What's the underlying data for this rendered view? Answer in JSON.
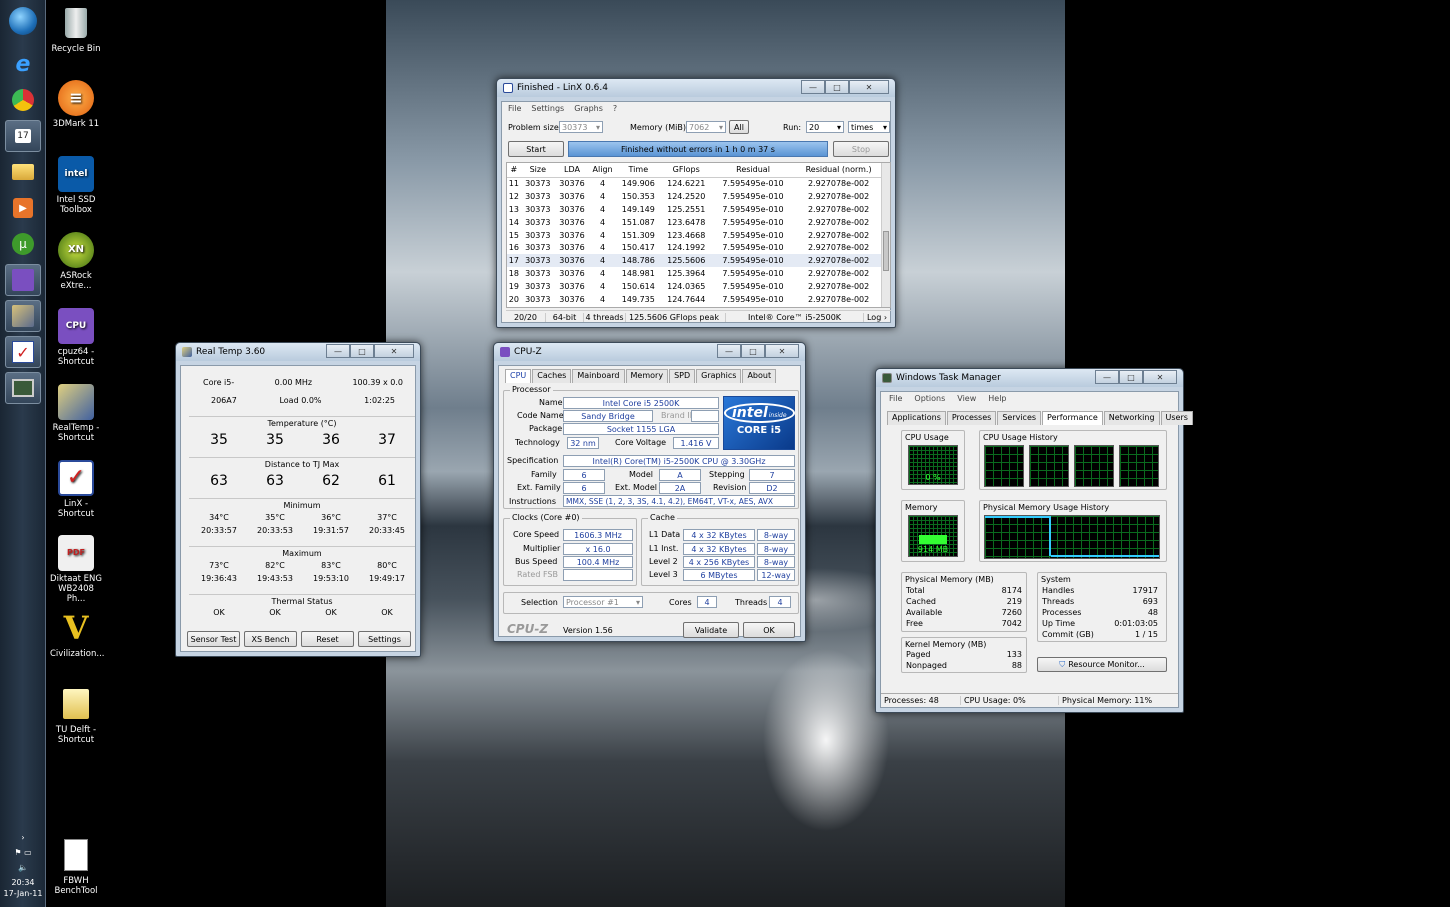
{
  "taskbar": {
    "clock_time": "20:34",
    "clock_date": "17-Jan-11"
  },
  "desktop_icons": [
    {
      "label": "Recycle Bin"
    },
    {
      "label": "3DMark 11"
    },
    {
      "label": "Intel SSD Toolbox"
    },
    {
      "label": "ASRock eXtre..."
    },
    {
      "label": "cpuz64 - Shortcut"
    },
    {
      "label": "RealTemp - Shortcut"
    },
    {
      "label": "LinX - Shortcut"
    },
    {
      "label": "Diktaat ENG WB2408 Ph..."
    },
    {
      "label": "Civilization..."
    },
    {
      "label": "TU Delft - Shortcut"
    },
    {
      "label": "FBWH BenchTool"
    }
  ],
  "linx": {
    "title": "Finished - LinX 0.6.4",
    "menu": [
      "File",
      "Settings",
      "Graphs",
      "?"
    ],
    "problem_size_label": "Problem size:",
    "problem_size": "30373",
    "memory_label": "Memory (MiB):",
    "memory": "7062",
    "all_label": "All",
    "run_label": "Run:",
    "run": "20",
    "run_unit": "times",
    "start_label": "Start",
    "status": "Finished without errors in 1 h 0 m 37 s",
    "stop_label": "Stop",
    "columns": [
      "#",
      "Size",
      "LDA",
      "Align",
      "Time",
      "GFlops",
      "Residual",
      "Residual (norm.)"
    ],
    "rows": [
      [
        "11",
        "30373",
        "30376",
        "4",
        "149.906",
        "124.6221",
        "7.595495e-010",
        "2.927078e-002"
      ],
      [
        "12",
        "30373",
        "30376",
        "4",
        "150.353",
        "124.2520",
        "7.595495e-010",
        "2.927078e-002"
      ],
      [
        "13",
        "30373",
        "30376",
        "4",
        "149.149",
        "125.2551",
        "7.595495e-010",
        "2.927078e-002"
      ],
      [
        "14",
        "30373",
        "30376",
        "4",
        "151.087",
        "123.6478",
        "7.595495e-010",
        "2.927078e-002"
      ],
      [
        "15",
        "30373",
        "30376",
        "4",
        "151.309",
        "123.4668",
        "7.595495e-010",
        "2.927078e-002"
      ],
      [
        "16",
        "30373",
        "30376",
        "4",
        "150.417",
        "124.1992",
        "7.595495e-010",
        "2.927078e-002"
      ],
      [
        "17",
        "30373",
        "30376",
        "4",
        "148.786",
        "125.5606",
        "7.595495e-010",
        "2.927078e-002"
      ],
      [
        "18",
        "30373",
        "30376",
        "4",
        "148.981",
        "125.3964",
        "7.595495e-010",
        "2.927078e-002"
      ],
      [
        "19",
        "30373",
        "30376",
        "4",
        "150.614",
        "124.0365",
        "7.595495e-010",
        "2.927078e-002"
      ],
      [
        "20",
        "30373",
        "30376",
        "4",
        "149.735",
        "124.7644",
        "7.595495e-010",
        "2.927078e-002"
      ]
    ],
    "status_bar": {
      "progress": "20/20",
      "arch": "64-bit",
      "threads": "4 threads",
      "peak": "125.5606 GFlops peak",
      "cpu": "Intel® Core™ i5-2500K",
      "log": "Log ›"
    }
  },
  "realtemp": {
    "title": "Real Temp 3.60",
    "cpu_name": "Core i5-",
    "mhz": "0.00 MHz",
    "multiplier": "100.39 x 0.0",
    "cpuid": "206A7",
    "load": "Load  0.0%",
    "uptime": "1:02:25",
    "temp_heading": "Temperature (°C)",
    "temps": [
      "35",
      "35",
      "36",
      "37"
    ],
    "tjmax_heading": "Distance to TJ Max",
    "distances": [
      "63",
      "63",
      "62",
      "61"
    ],
    "min_heading": "Minimum",
    "min_temps": [
      "34°C",
      "35°C",
      "36°C",
      "37°C"
    ],
    "min_times": [
      "20:33:57",
      "20:33:53",
      "19:31:57",
      "20:33:45"
    ],
    "max_heading": "Maximum",
    "max_temps": [
      "73°C",
      "82°C",
      "83°C",
      "80°C"
    ],
    "max_times": [
      "19:36:43",
      "19:43:53",
      "19:53:10",
      "19:49:17"
    ],
    "thermal_heading": "Thermal Status",
    "thermal": [
      "OK",
      "OK",
      "OK",
      "OK"
    ],
    "buttons": [
      "Sensor Test",
      "XS Bench",
      "Reset",
      "Settings"
    ]
  },
  "cpuz": {
    "title": "CPU-Z",
    "tabs": [
      "CPU",
      "Caches",
      "Mainboard",
      "Memory",
      "SPD",
      "Graphics",
      "About"
    ],
    "processor_group": "Processor",
    "name_label": "Name",
    "name": "Intel Core i5 2500K",
    "codename_label": "Code Name",
    "codename": "Sandy Bridge",
    "brand_id_label": "Brand ID",
    "package_label": "Package",
    "package": "Socket 1155 LGA",
    "technology_label": "Technology",
    "technology": "32 nm",
    "core_voltage_label": "Core Voltage",
    "core_voltage": "1.416 V",
    "spec_label": "Specification",
    "spec": "Intel(R) Core(TM) i5-2500K CPU @ 3.30GHz",
    "family_label": "Family",
    "family": "6",
    "model_label": "Model",
    "model": "A",
    "stepping_label": "Stepping",
    "stepping": "7",
    "ext_family_label": "Ext. Family",
    "ext_family": "6",
    "ext_model_label": "Ext. Model",
    "ext_model": "2A",
    "revision_label": "Revision",
    "revision": "D2",
    "instructions_label": "Instructions",
    "instructions": "MMX, SSE (1, 2, 3, 3S, 4.1, 4.2), EM64T, VT-x, AES, AVX",
    "logo_top": "intel",
    "logo_inside": "inside",
    "logo_bottom": "CORE i5",
    "clocks_group": "Clocks (Core #0)",
    "core_speed_label": "Core Speed",
    "core_speed": "1606.3 MHz",
    "multiplier_label": "Multiplier",
    "multiplier": "x 16.0",
    "bus_speed_label": "Bus Speed",
    "bus_speed": "100.4 MHz",
    "rated_fsb_label": "Rated FSB",
    "cache_group": "Cache",
    "l1d_label": "L1 Data",
    "l1d": "4 x 32 KBytes",
    "l1d_way": "8-way",
    "l1i_label": "L1 Inst.",
    "l1i": "4 x 32 KBytes",
    "l1i_way": "8-way",
    "l2_label": "Level 2",
    "l2": "4 x 256 KBytes",
    "l2_way": "8-way",
    "l3_label": "Level 3",
    "l3": "6 MBytes",
    "l3_way": "12-way",
    "selection_label": "Selection",
    "selection": "Processor #1",
    "cores_label": "Cores",
    "cores": "4",
    "threads_label": "Threads",
    "threads": "4",
    "brand": "CPU-Z",
    "version": "Version 1.56",
    "validate_label": "Validate",
    "ok_label": "OK"
  },
  "taskmgr": {
    "title": "Windows Task Manager",
    "menu": [
      "File",
      "Options",
      "View",
      "Help"
    ],
    "tabs": [
      "Applications",
      "Processes",
      "Services",
      "Performance",
      "Networking",
      "Users"
    ],
    "cpu_usage_label": "CPU Usage",
    "cpu_usage": "0 %",
    "cpu_history_label": "CPU Usage History",
    "memory_label": "Memory",
    "memory": "914 MB",
    "mem_history_label": "Physical Memory Usage History",
    "physmem_heading": "Physical Memory (MB)",
    "physmem": [
      [
        "Total",
        "8174"
      ],
      [
        "Cached",
        "219"
      ],
      [
        "Available",
        "7260"
      ],
      [
        "Free",
        "7042"
      ]
    ],
    "kernel_heading": "Kernel Memory (MB)",
    "kernel": [
      [
        "Paged",
        "133"
      ],
      [
        "Nonpaged",
        "88"
      ]
    ],
    "system_heading": "System",
    "system": [
      [
        "Handles",
        "17917"
      ],
      [
        "Threads",
        "693"
      ],
      [
        "Processes",
        "48"
      ],
      [
        "Up Time",
        "0:01:03:05"
      ],
      [
        "Commit (GB)",
        "1 / 15"
      ]
    ],
    "resource_monitor_label": "Resource Monitor...",
    "status_processes": "Processes: 48",
    "status_cpu": "CPU Usage: 0%",
    "status_mem": "Physical Memory: 11%",
    "memory_fraction": 0.11
  }
}
